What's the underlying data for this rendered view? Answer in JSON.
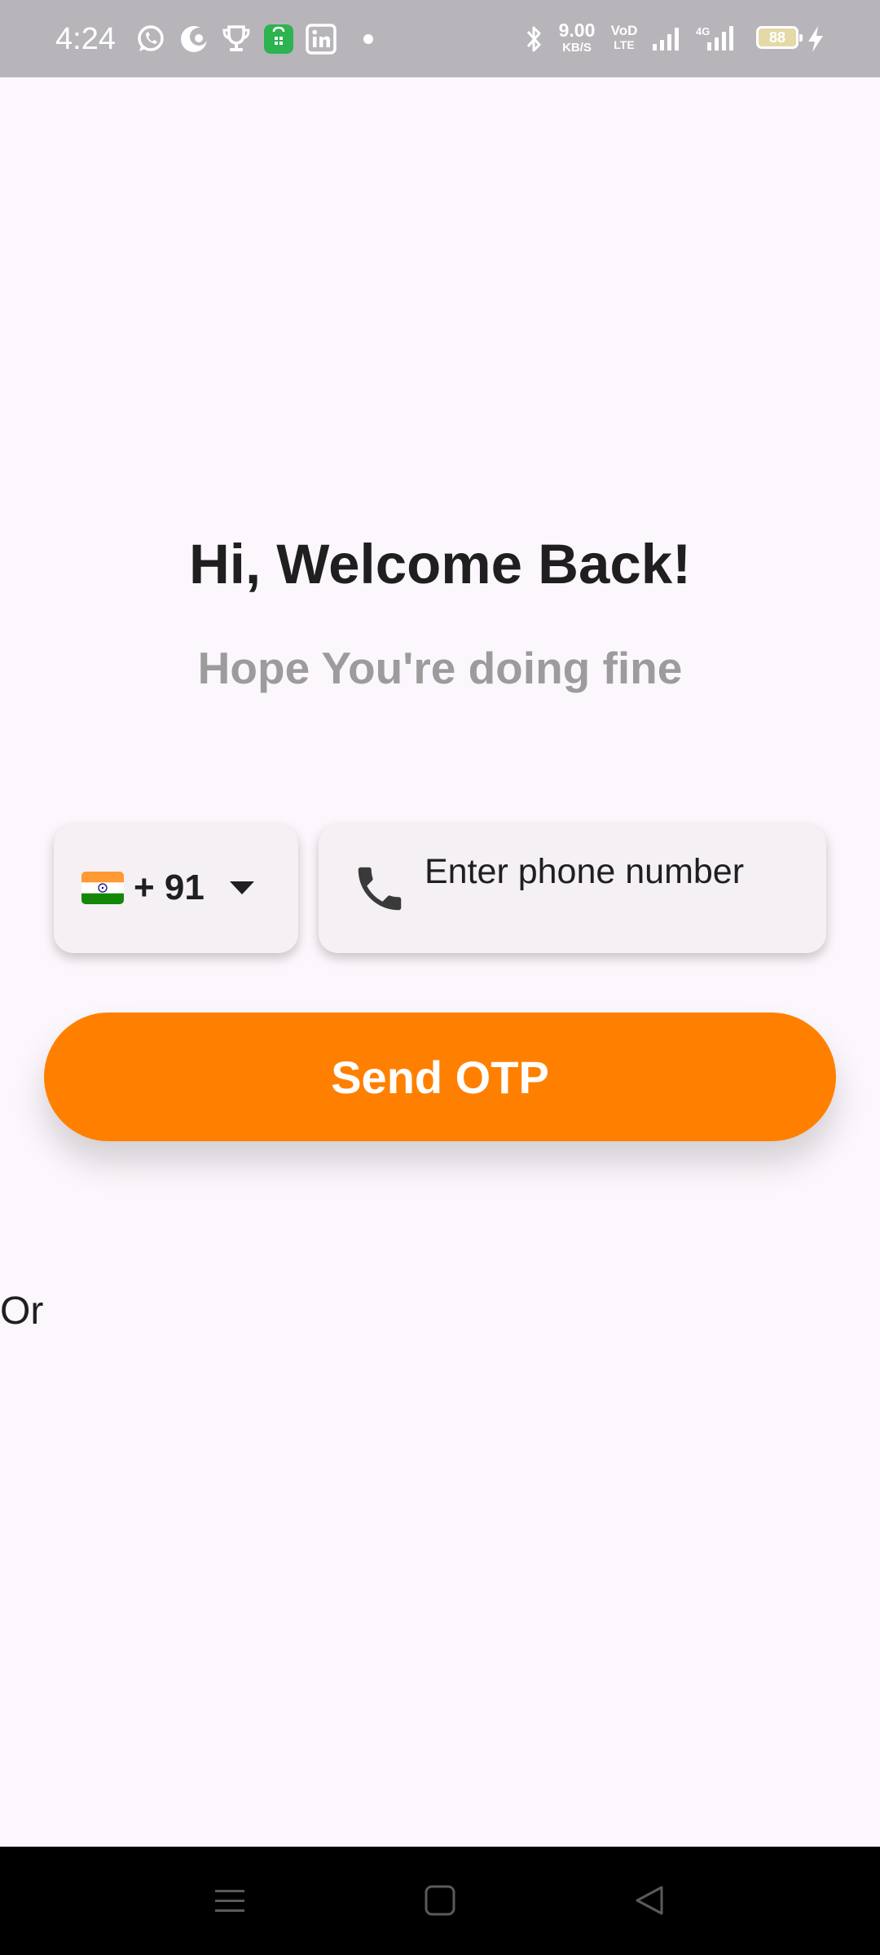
{
  "status_bar": {
    "time": "4:24",
    "notification_icons": [
      "whatsapp-icon",
      "moon-app-icon",
      "trophy-icon",
      "shopping-bag-icon",
      "linkedin-icon",
      "dot-icon"
    ],
    "net_speed_value": "9.00",
    "net_speed_unit": "KB/S",
    "volte_top": "VoD",
    "volte_bottom": "LTE",
    "network_label": "4G",
    "battery_level": "88",
    "charging": true
  },
  "welcome": {
    "title": "Hi, Welcome Back!",
    "subtitle": "Hope You're doing fine"
  },
  "phone_form": {
    "country_flag": "India",
    "dial_code": "+ 91",
    "phone_placeholder": "Enter phone number",
    "phone_value": ""
  },
  "send_otp": {
    "label": "Send OTP",
    "color": "#FF8000"
  },
  "divider_text": "Or",
  "nav_bar": {
    "buttons": [
      "menu-icon",
      "home-icon",
      "back-icon"
    ]
  },
  "colors": {
    "background": "#FCF7FC",
    "status_bar": "#B8B5BA",
    "field_background": "#F4F0F4",
    "title_text": "#1F1F1F",
    "subtitle_text": "#9C9C9C"
  }
}
